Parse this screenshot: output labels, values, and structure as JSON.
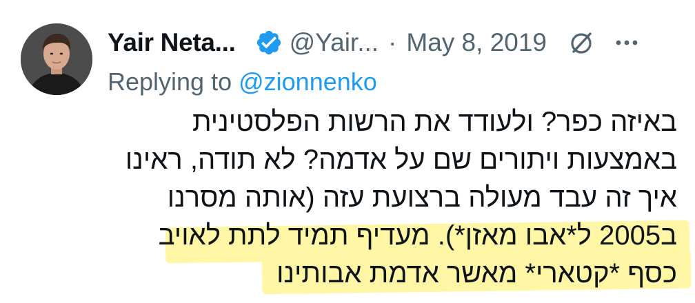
{
  "tweet": {
    "author": {
      "display_name": "Yair Neta...",
      "handle": "@Yair...",
      "verified": true
    },
    "separator": "·",
    "date": "May 8, 2019",
    "replying_prefix": "Replying to ",
    "replying_to": "@zionnenko",
    "body_lines": [
      "באיזה כפר? ולעודד את הרשות הפלסטינית",
      "באמצעות ויתורים שם על אדמה? לא תודה, ראינו",
      "איך זה עבד מעולה ברצועת עזה (אותה מסרנו",
      "ב2005 ל*אבו מאזן*). מעדיף תמיד לתת לאויב",
      "כסף *קטארי* מאשר אדמת אבותינו"
    ]
  },
  "icons": {
    "verified": "verified-badge-icon",
    "grok": "grok-icon",
    "more": "more-options-icon"
  },
  "colors": {
    "text": "#0f1419",
    "secondary": "#536471",
    "accent": "#1d9bf0",
    "highlight": "#fff7a6"
  }
}
